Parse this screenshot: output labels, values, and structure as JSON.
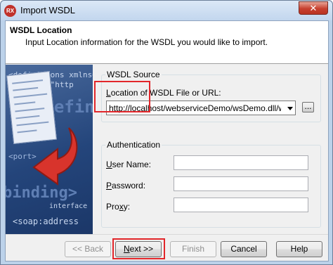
{
  "window": {
    "title": "Import WSDL",
    "app_icon_text": "RX",
    "close_label": "✕"
  },
  "header": {
    "title": "WSDL Location",
    "description": "Input Location information for the WSDL you would like to import."
  },
  "side_image": {
    "lines": [
      "<definitions xmlns=\"ht",
      "xmlns:xs=\"http",
      "<port>",
      "<soap:address"
    ],
    "big_words": [
      "<defini",
      "binding>"
    ],
    "small_word": "interface"
  },
  "wsdl_source": {
    "group_title": "WSDL Source",
    "location_label_prefix": "L",
    "location_label_rest": "ocation of WSDL File or URL:",
    "location_value": "http://localhost/webserviceDemo/wsDemo.dll/wsdl/",
    "browse_label": "..."
  },
  "authentication": {
    "group_title": "Authentication",
    "username_prefix": "U",
    "username_rest": "ser Name:",
    "password_prefix": "P",
    "password_rest": "assword:",
    "proxy_prefix": "Pro",
    "proxy_accel": "x",
    "proxy_rest": "y:",
    "username_value": "",
    "password_value": "",
    "proxy_value": ""
  },
  "buttons": {
    "back": "<< Back",
    "next_prefix": "N",
    "next_rest": "ext >>",
    "finish": "Finish",
    "cancel": "Cancel",
    "help": "Help"
  },
  "colors": {
    "highlight": "#e2262a",
    "side_background": "#24457b"
  }
}
